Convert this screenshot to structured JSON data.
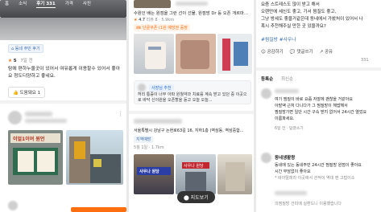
{
  "panel1": {
    "tabs": [
      "홈",
      "소식",
      "후기 331",
      "가격",
      "사진"
    ],
    "neighbor_badge": "동네 주민 후기",
    "rating": "5",
    "time": "7일 전",
    "review_text": "탐에 편하누울곳이 있어서 여유롭게 이용할수 있어서 좋아요 청도디양하고 좋네요.",
    "help_label": "도움돼요",
    "help_count": "1",
    "sign_text": "이얼1이여 원언",
    "avatar2_name": "",
    "blur_sub": ""
  },
  "panel2": {
    "intro_text": "수원인 배는 원점을 그런 선이 선물, 원점방 Dr 등 오픈 개르마...",
    "meta_rating": "4.7",
    "meta_text": "리뷰 8 · 5.9km",
    "coupon": "단골쿠폰 (1원 예방권 증정",
    "badge_best": "사장님 추천",
    "review_snippet": "허리 통증이 너무 아파 원월약과 치료를 계속 받고 있던 중 이곳으로 바닥 신이원을 오픈할을 듣고 오늘 오늘...",
    "address": "서울특별시 강남구 논현로63길 16, 지하1층 (역삼동, 역삼중합...",
    "tag": "지역예방",
    "hours": "5월 1일 · 1.7km",
    "thumb_label1": "사우나 원당",
    "thumb_label2": "사우나 원당",
    "map_button": "지도보기"
  },
  "panel3": {
    "top_text_1": "요즘 스트레스도 많이 받고 해서",
    "top_text_2": "오랜만에 세신도 좋고, 가서 찜질도 좋고,",
    "top_text_3": "그냥 방세도 좋을거같은데 동네에서 가봤처이 있어서 나",
    "top_text_4": "혹시 추천해주실 만한 곳 있을까요?",
    "hashtags": "#찜질방 #사우나",
    "like_label": "공감하기",
    "comment_label": "댓글쓰기",
    "share_label": "공유",
    "count_right": "331",
    "sort_title": "등록순",
    "sort_latest": "최신순",
    "c1_text_1": "여기 찜질이 바로 요즘 자잘에 괜찮을 거같아요",
    "c1_text_2": "아발액 근처 다니다가 그 찜질방이 헤밥해서",
    "c1_text_3": "찜질방가면 일단 시간 구속 받지 없어서 24시간 열었요",
    "c1_text_4": "이름파세요.",
    "c1_meta": "6일 전 · 답글쓰기",
    "reply_label": "동네생활왕",
    "c2_text_1": "동네에 있는 동네주민 24시간 찜질방 원점이 좋아요",
    "c2_text_2": "시간 부담없이 좋아요",
    "c2_text_3": "* 바이탈레라 이곳에서 관적이 역대 편 고맙이소",
    "c3_text": "의찜질방 건미에 실환드니 이용했습니다"
  }
}
